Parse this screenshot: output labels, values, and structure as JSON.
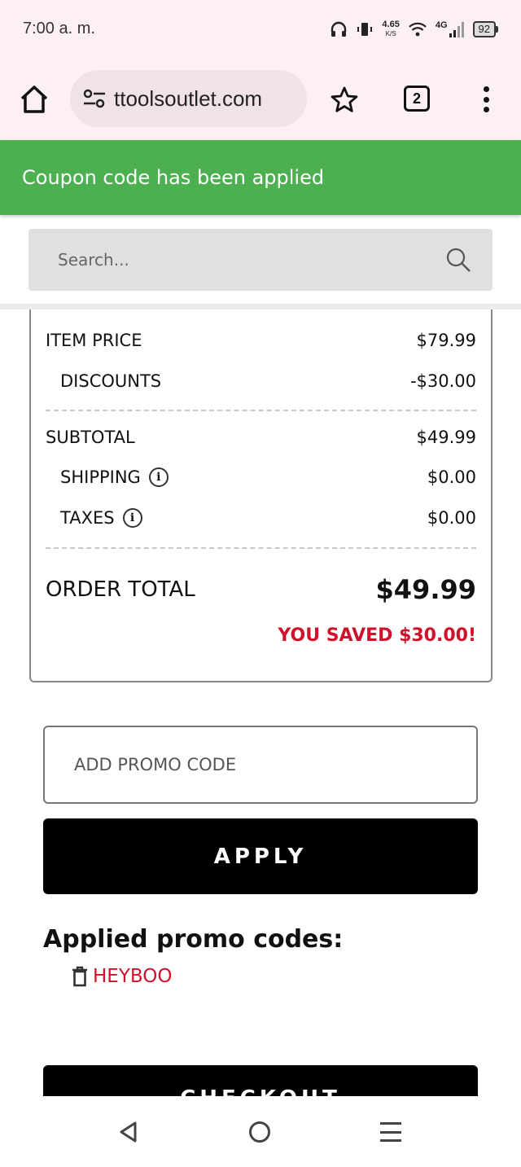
{
  "status_bar": {
    "time": "7:00 a. m.",
    "speed_value": "4.65",
    "speed_unit": "K/S",
    "network": "4G",
    "battery": "92"
  },
  "browser": {
    "url": "ttoolsoutlet.com",
    "tab_count": "2"
  },
  "toast": {
    "message": "Coupon code has been applied",
    "color": "#4caf50"
  },
  "search": {
    "placeholder": "Search..."
  },
  "summary": {
    "item_price_label": "ITEM PRICE",
    "item_price_value": "$79.99",
    "discounts_label": "DISCOUNTS",
    "discounts_value": "-$30.00",
    "subtotal_label": "SUBTOTAL",
    "subtotal_value": "$49.99",
    "shipping_label": "SHIPPING",
    "shipping_value": "$0.00",
    "taxes_label": "TAXES",
    "taxes_value": "$0.00",
    "order_total_label": "ORDER TOTAL",
    "order_total_value": "$49.99",
    "saved_text": "YOU SAVED $30.00!"
  },
  "promo": {
    "placeholder": "ADD PROMO CODE",
    "apply_label": "APPLY",
    "applied_title": "Applied promo codes:",
    "applied_codes": [
      "HEYBOO"
    ],
    "accent_color": "#d0112b"
  },
  "checkout": {
    "label": "CHECKOUT"
  }
}
